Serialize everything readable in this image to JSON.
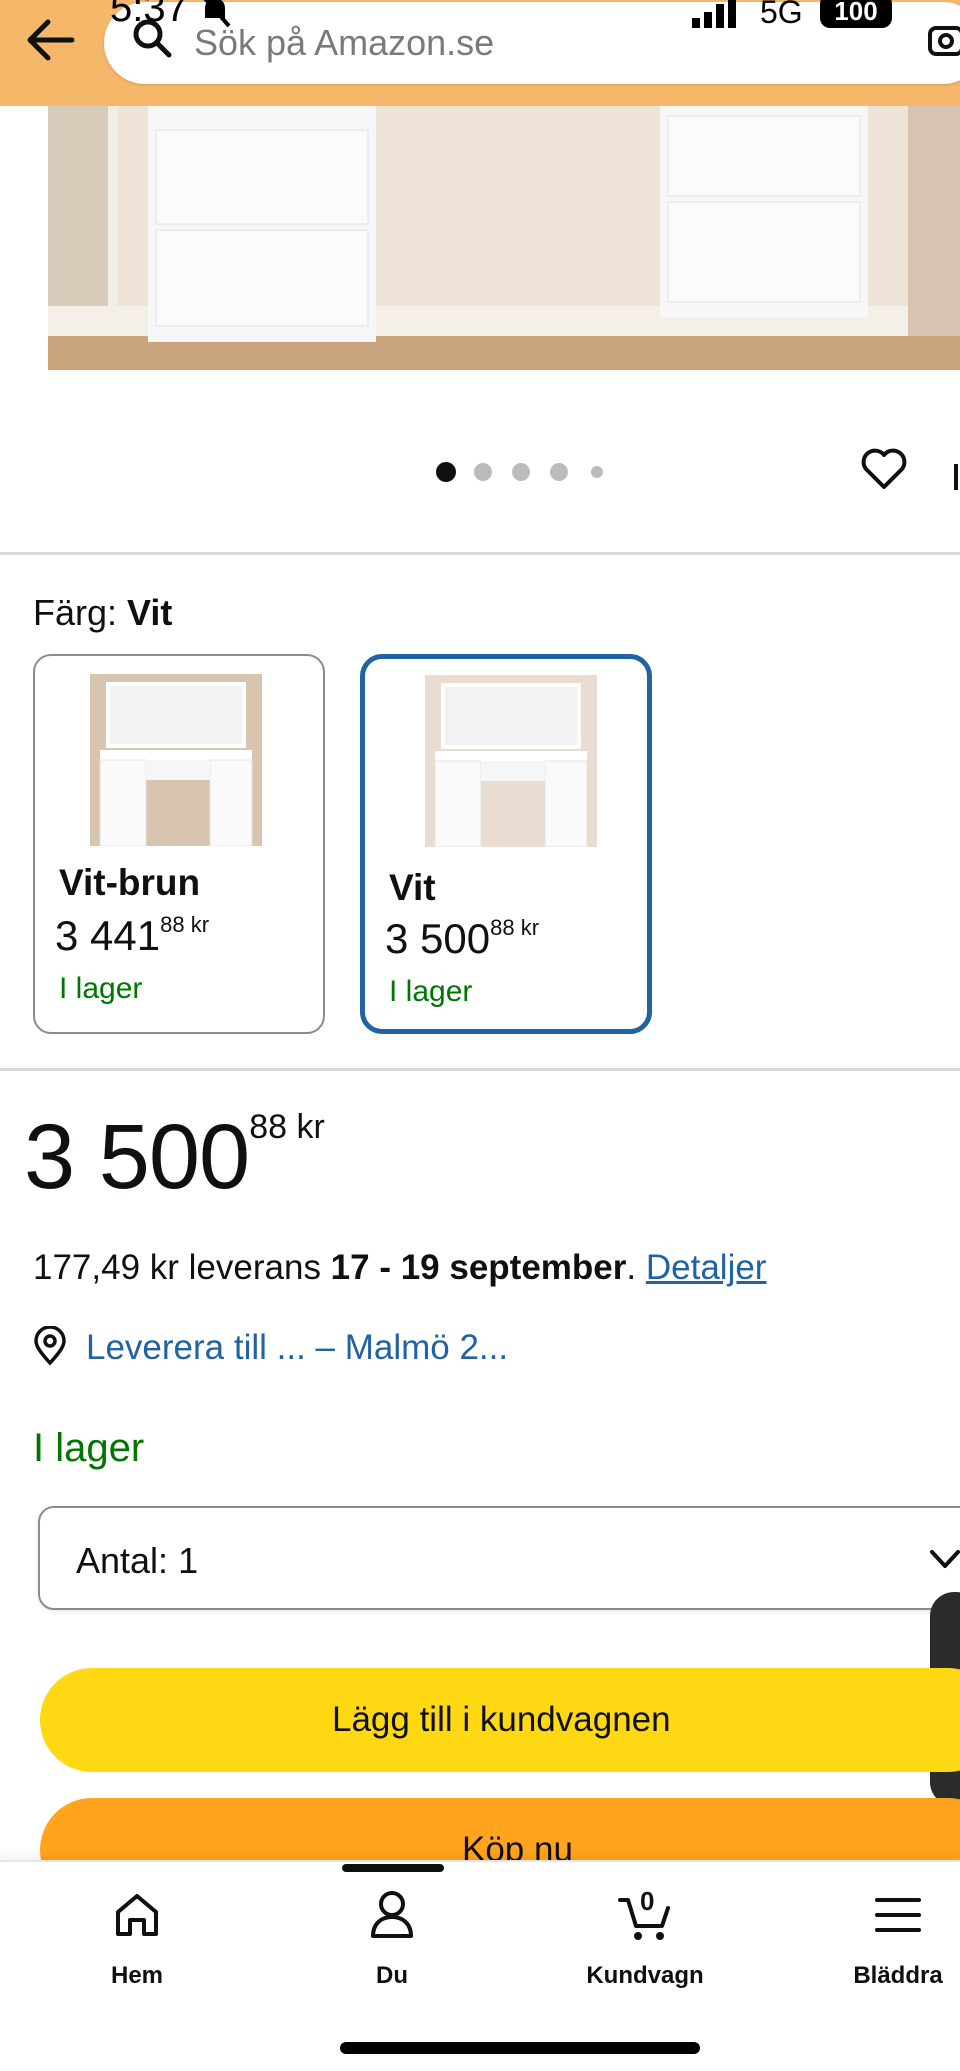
{
  "status_bar": {
    "time": "5:37",
    "network": "5G",
    "battery": "100"
  },
  "search": {
    "placeholder": "Sök på Amazon.se"
  },
  "carousel": {
    "image_count": 5,
    "active_index": 0
  },
  "color": {
    "label": "Färg:",
    "selected_value": "Vit",
    "options": [
      {
        "name": "Vit-brun",
        "price_whole": "3 441",
        "price_fraction": "88",
        "currency": "kr",
        "stock": "I lager",
        "selected": false
      },
      {
        "name": "Vit",
        "price_whole": "3 500",
        "price_fraction": "88",
        "currency": "kr",
        "stock": "I lager",
        "selected": true
      }
    ]
  },
  "price": {
    "whole": "3 500",
    "fraction": "88",
    "currency": "kr"
  },
  "delivery": {
    "fee": "177,49 kr leverans ",
    "dates": "17 - 19 september",
    "period": ".",
    "details_link": "Detaljer"
  },
  "deliver_to": {
    "text": "Leverera till ... – Malmö 2..."
  },
  "stock_status": "I lager",
  "quantity": {
    "label": "Antal:",
    "value": "1"
  },
  "buttons": {
    "add_to_cart": "Lägg till i kundvagnen",
    "buy_now": "Köp nu"
  },
  "bottom_nav": {
    "items": [
      {
        "label": "Hem",
        "icon": "home-icon"
      },
      {
        "label": "Du",
        "icon": "user-icon"
      },
      {
        "label": "Kundvagn",
        "icon": "cart-icon",
        "badge": "0"
      },
      {
        "label": "Bläddra",
        "icon": "menu-icon"
      }
    ]
  },
  "colors": {
    "accent": "#f5b86b",
    "link": "#2162a1",
    "stock": "#007600",
    "cart_button": "#ffd814",
    "buy_button": "#ffa41c"
  }
}
